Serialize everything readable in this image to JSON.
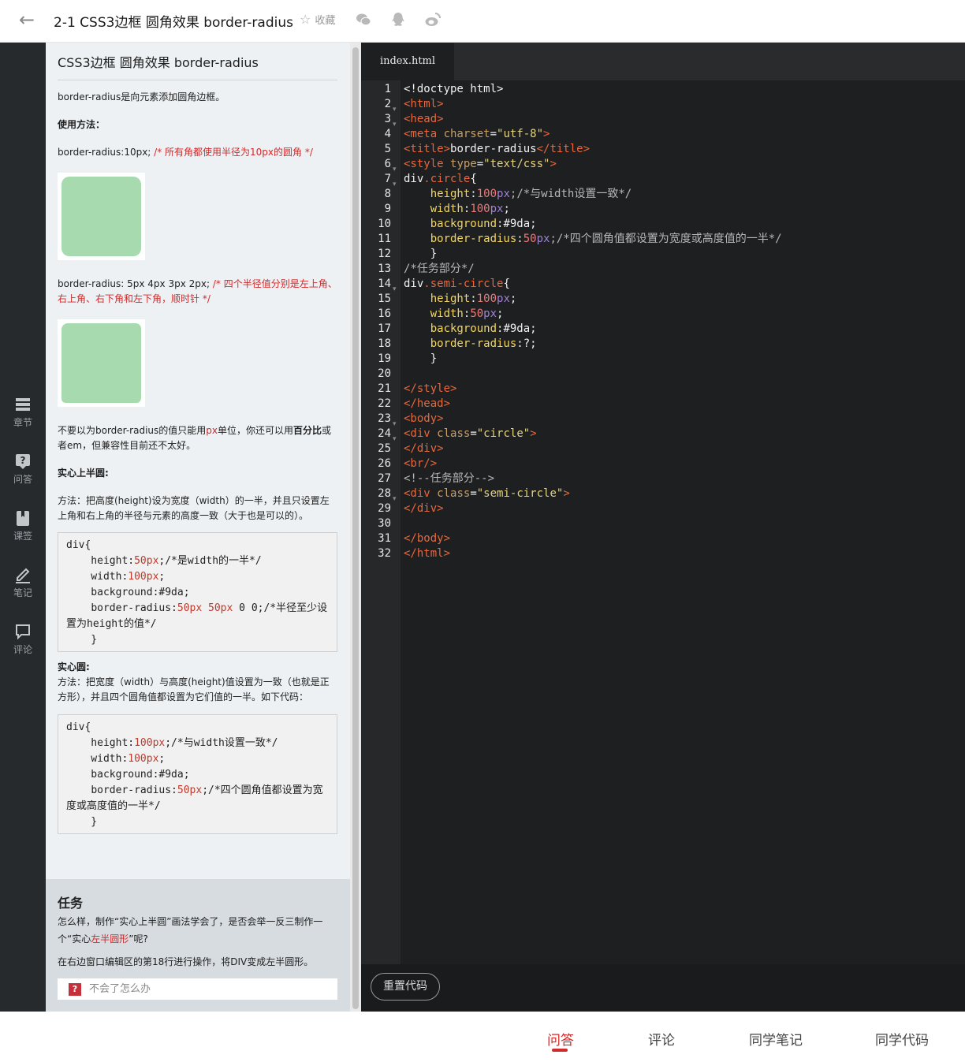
{
  "header": {
    "title": "2-1 CSS3边框 圆角效果 border-radius",
    "favorite_label": "收藏",
    "share_icons": [
      "wechat-icon",
      "qq-icon",
      "weibo-icon"
    ]
  },
  "rail": {
    "items": [
      {
        "icon": "chapter-icon",
        "label": "章节"
      },
      {
        "icon": "question-icon",
        "label": "问答"
      },
      {
        "icon": "bookmark-icon",
        "label": "课签"
      },
      {
        "icon": "pencil-icon",
        "label": "笔记"
      },
      {
        "icon": "comment-icon",
        "label": "评论"
      }
    ]
  },
  "lesson": {
    "title": "CSS3边框 圆角效果 border-radius",
    "intro": " border-radius是向元素添加圆角边框。",
    "usage_heading": "使用方法：",
    "ex1_code": "border-radius:10px; ",
    "ex1_comment": "/* 所有角都使用半径为10px的圆角 */",
    "ex2_code": "border-radius: 5px 4px 3px 2px; ",
    "ex2_comment": "/* 四个半径值分别是左上角、右上角、右下角和左下角，顺时针 */",
    "units_p1": "不要以为border-radius的值只能用",
    "units_px": "px",
    "units_p2": "单位，你还可以用",
    "units_pct": "百分比",
    "units_p3": "或者em，但兼容性目前还不太好。",
    "half_heading": "实心上半圆:",
    "half_desc": "方法：把高度(height)设为宽度（width）的一半，并且只设置左上角和右上角的半径与元素的高度一致（大于也是可以的）。",
    "code1": {
      "l1": "div{",
      "l2a": "    height:",
      "l2b": "50px",
      "l2c": ";/*是width的一半*/",
      "l3a": "    width:",
      "l3b": "100px",
      "l3c": ";",
      "l4": "    background:#9da;",
      "l5a": "    border-radius:",
      "l5b": "50px 50px",
      "l5c": " 0 0;/*半径至少设置为height的值*/",
      "l6": "    }"
    },
    "circle_heading": "实心圆:",
    "circle_desc": "方法：把宽度（width）与高度(height)值设置为一致（也就是正方形），并且四个圆角值都设置为它们值的一半。如下代码：",
    "code2": {
      "l1": "div{",
      "l2a": "    height:",
      "l2b": "100px",
      "l2c": ";/*与width设置一致*/",
      "l3a": "    width:",
      "l3b": "100px",
      "l3c": ";",
      "l4": "    background:#9da;",
      "l5a": "    border-radius:",
      "l5b": "50px",
      "l5c": ";/*四个圆角值都设置为宽度或高度值的一半*/",
      "l6": "    }"
    }
  },
  "task": {
    "title": "任务",
    "p1a": "怎么样，制作“实心上半圆”画法学会了，是否会举一反三制作一个“实心",
    "p1b": "左半圆形",
    "p1c": "”呢?",
    "p2": "在右边窗口编辑区的第18行进行操作，将DIV变成左半圆形。",
    "help": "不会了怎么办",
    "help_icon": "?"
  },
  "editor": {
    "tab": "index.html",
    "line_numbers": [
      "1",
      "2",
      "3",
      "4",
      "5",
      "6",
      "7",
      "8",
      "9",
      "10",
      "11",
      "12",
      "13",
      "14",
      "15",
      "16",
      "17",
      "18",
      "19",
      "20",
      "21",
      "22",
      "23",
      "24",
      "25",
      "26",
      "27",
      "28",
      "29",
      "30",
      "31",
      "32"
    ],
    "reset": "重置代码",
    "code": {
      "l1": "<!doctype html>",
      "l2": "<html>",
      "l3": "<head>",
      "l4a": "<meta ",
      "l4b": "charset",
      "l4c": "=",
      "l4d": "\"utf-8\"",
      "l4e": ">",
      "l5a": "<title>",
      "l5b": "border-radius",
      "l5c": "</title>",
      "l6a": "<style ",
      "l6b": "type",
      "l6c": "=",
      "l6d": "\"text/css\"",
      "l6e": ">",
      "l7a": "div",
      "l7b": ".circle",
      "l7c": "{",
      "l8a": "    ",
      "l8b": "height",
      "l8c": ":",
      "l8d": "100",
      "l8e": "px",
      "l8f": ";/*与width设置一致*/",
      "l9a": "    ",
      "l9b": "width",
      "l9c": ":",
      "l9d": "100",
      "l9e": "px",
      "l9f": ";",
      "l10a": "    ",
      "l10b": "background",
      "l10c": ":#9da;",
      "l11a": "    ",
      "l11b": "border-radius",
      "l11c": ":",
      "l11d": "50",
      "l11e": "px",
      "l11f": ";/*四个圆角值都设置为宽度或高度值的一半*/",
      "l12": "    }",
      "l13": "/*任务部分*/",
      "l14a": "div",
      "l14b": ".semi-circle",
      "l14c": "{",
      "l15a": "    ",
      "l15b": "height",
      "l15c": ":",
      "l15d": "100",
      "l15e": "px",
      "l15f": ";",
      "l16a": "    ",
      "l16b": "width",
      "l16c": ":",
      "l16d": "50",
      "l16e": "px",
      "l16f": ";",
      "l17a": "    ",
      "l17b": "background",
      "l17c": ":#9da;",
      "l18a": "    ",
      "l18b": "border-radius",
      "l18c": ":?;",
      "l19": "    }",
      "l21": "</style>",
      "l22": "</head>",
      "l23": "<body>",
      "l24a": "<div ",
      "l24b": "class",
      "l24c": "=",
      "l24d": "\"circle\"",
      "l24e": ">",
      "l25": "</div>",
      "l26": "<br/>",
      "l27": "<!--任务部分-->",
      "l28a": "<div ",
      "l28b": "class",
      "l28c": "=",
      "l28d": "\"semi-circle\"",
      "l28e": ">",
      "l29": "</div>",
      "l31": "</body>",
      "l32": "</html>"
    }
  },
  "bottom_tabs": [
    "问答",
    "评论",
    "同学笔记",
    "同学代码"
  ],
  "colors": {
    "accent": "#d12a2a",
    "demo_fill": "#a8dab0",
    "editor_bg": "#1e1f20",
    "rail_bg": "#262a2c"
  }
}
